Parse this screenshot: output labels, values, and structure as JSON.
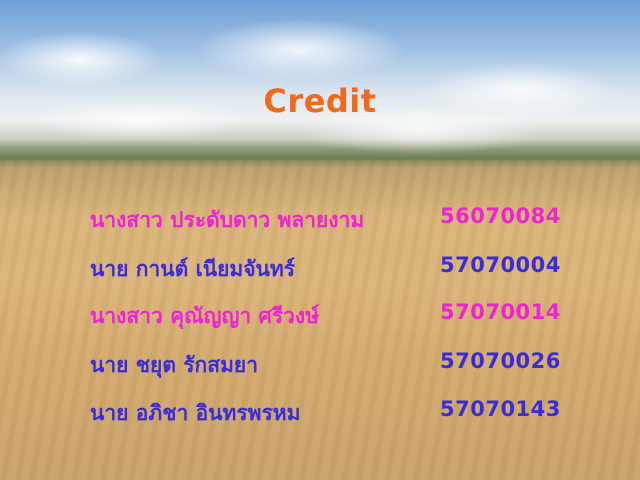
{
  "title": "Credit",
  "credits": [
    {
      "name": "นางสาว ประดับดาว พลายงาม",
      "id": "56070084",
      "color": "#ee22d6"
    },
    {
      "name": "นาย กานต์ เนียมจันทร์",
      "id": "57070004",
      "color": "#3a2cd8"
    },
    {
      "name": "นางสาว คุณัญญา ศรีวงษ์",
      "id": "57070014",
      "color": "#ee22d6"
    },
    {
      "name": "นาย ชยุต รักสมยา",
      "id": "57070026",
      "color": "#3a2cd8"
    },
    {
      "name": "นาย อภิชา อินทรพรหม",
      "id": "57070143",
      "color": "#3a2cd8"
    }
  ]
}
